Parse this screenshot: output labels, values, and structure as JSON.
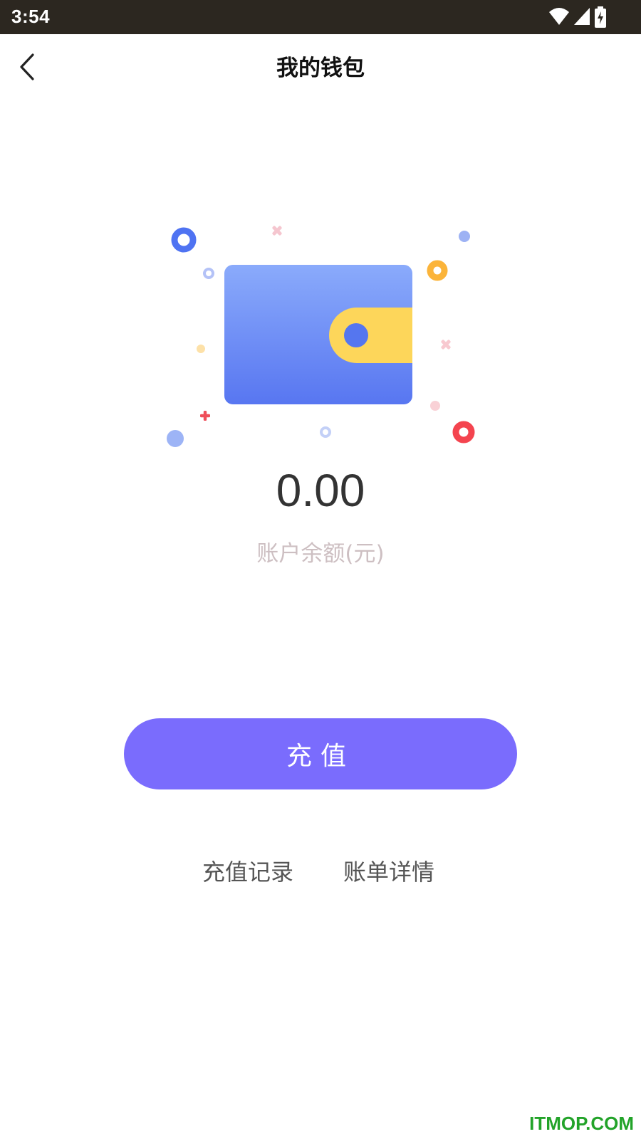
{
  "status_bar": {
    "time": "3:54"
  },
  "header": {
    "title": "我的钱包"
  },
  "wallet": {
    "balance": "0.00",
    "balance_label": "账户余额(元)"
  },
  "actions": {
    "recharge_label": "充值",
    "records_label": "充值记录",
    "bills_label": "账单详情"
  },
  "watermark": "ITMOP.COM",
  "colors": {
    "primary_button": "#7a6cfd",
    "wallet_blue": "#5b7cf5",
    "wallet_clasp": "#ffd54f",
    "balance_label": "#cdbfc2"
  }
}
